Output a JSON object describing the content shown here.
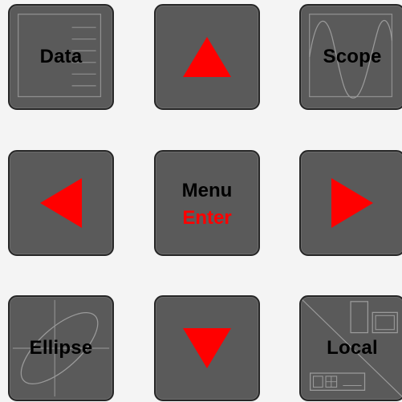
{
  "keypad": {
    "data": {
      "label": "Data"
    },
    "up": {
      "icon": "arrow-up-icon"
    },
    "scope": {
      "label": "Scope"
    },
    "left": {
      "icon": "arrow-left-icon"
    },
    "menu": {
      "label_top": "Menu",
      "label_bottom": "Enter"
    },
    "right": {
      "icon": "arrow-right-icon"
    },
    "ellipse": {
      "label": "Ellipse"
    },
    "down": {
      "icon": "arrow-down-icon"
    },
    "local": {
      "label": "Local"
    }
  },
  "colors": {
    "pad_face": "#5a5a5a",
    "pad_border": "#262626",
    "arrow_red": "#ff0000",
    "deco_line": "#9a9a9a",
    "background": "#f4f4f4"
  }
}
